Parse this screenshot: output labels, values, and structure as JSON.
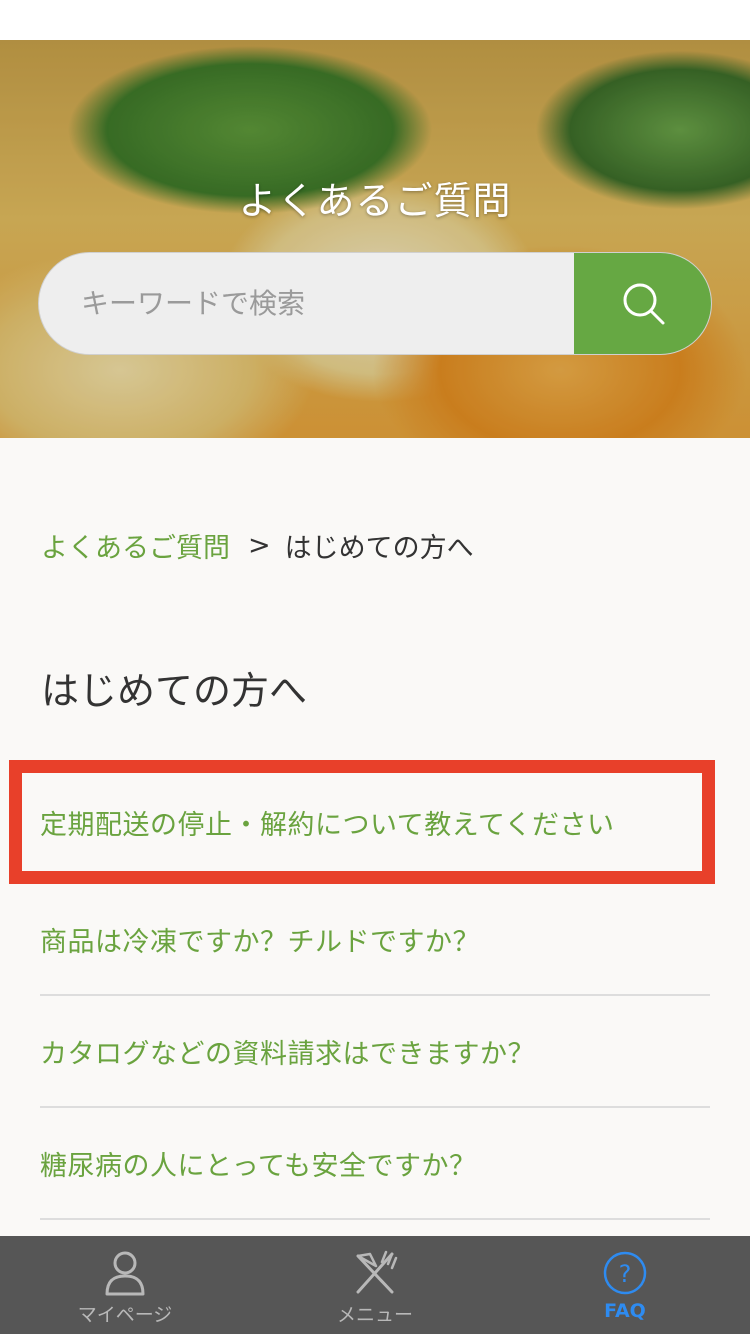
{
  "hero": {
    "title": "よくあるご質問",
    "search_placeholder": "キーワードで検索",
    "search_icon": "search-icon"
  },
  "breadcrumb": {
    "root": "よくあるご質問",
    "separator": ">",
    "current": "はじめての方へ"
  },
  "page": {
    "title": "はじめての方へ"
  },
  "faq": {
    "items": [
      {
        "label": "定期配送の停止・解約について教えてください"
      },
      {
        "label": "商品は冷凍ですか？チルドですか？"
      },
      {
        "label": "カタログなどの資料請求はできますか？"
      },
      {
        "label": "糖尿病の人にとっても安全ですか？"
      }
    ]
  },
  "tabbar": {
    "items": [
      {
        "label": "マイページ",
        "icon": "person-icon"
      },
      {
        "label": "メニュー",
        "icon": "fork-knife-icon"
      },
      {
        "label": "FAQ",
        "icon": "question-circle-icon",
        "active": true
      }
    ]
  },
  "colors": {
    "accent_green": "#66a843",
    "link_green": "#6aa33f",
    "highlight_red": "#e8402a",
    "tab_active_blue": "#2e8bf0",
    "tabbar_bg": "#565656"
  }
}
